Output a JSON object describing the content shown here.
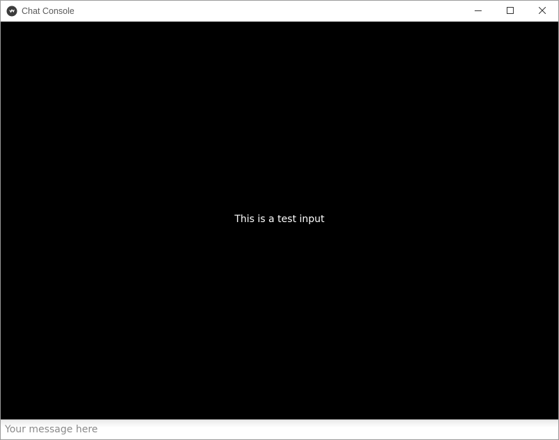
{
  "window": {
    "title": "Chat Console",
    "controls": {
      "minimize_icon": "minimize-icon",
      "maximize_icon": "maximize-icon",
      "close_icon": "close-icon"
    }
  },
  "chat": {
    "messages": [
      "This is a test input"
    ]
  },
  "input": {
    "value": "",
    "placeholder": "Your message here"
  },
  "colors": {
    "background": "#000000",
    "message_text": "#ffffff",
    "titlebar": "#ffffff"
  }
}
